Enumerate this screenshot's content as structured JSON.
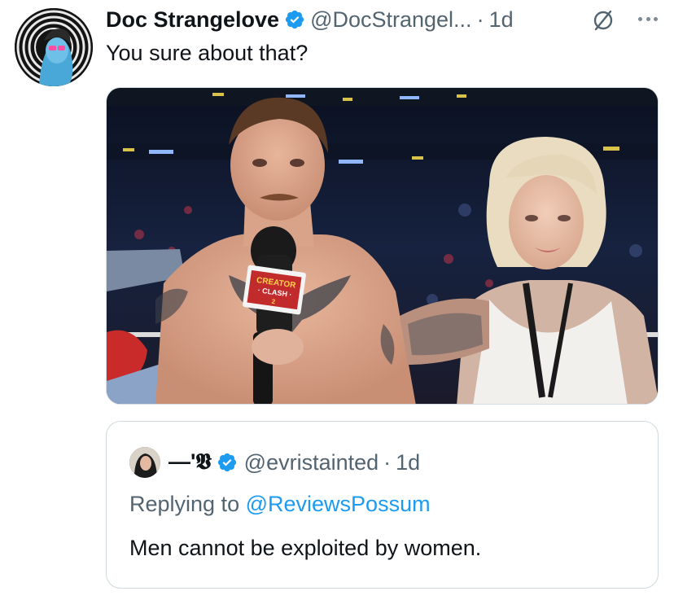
{
  "tweet": {
    "display_name": "Doc Strangelove",
    "handle": "@DocStrangel...",
    "separator": "·",
    "time": "1d",
    "text": "You sure about that?",
    "verified_color": "#1d9bf0",
    "icons": {
      "avatar": "profile-avatar",
      "verified": "verified-badge-icon",
      "grok": "slashed-circle-icon",
      "more": "more-options-icon"
    },
    "media": {
      "kind": "photo",
      "mic_flag_line1": "CREATOR",
      "mic_flag_line2": "· CLASH ·",
      "mic_flag_line3": "2"
    }
  },
  "quoted_tweet": {
    "display_name": "—'𝖁",
    "handle": "@evristainted",
    "separator": "·",
    "time": "1d",
    "replying_prefix": "Replying to",
    "replying_mention": "@ReviewsPossum",
    "text": "Men cannot be exploited by women."
  },
  "colors": {
    "accent": "#1d9bf0",
    "secondary_text": "#536471",
    "primary_text": "#0f1419",
    "border": "#cfd9de"
  }
}
